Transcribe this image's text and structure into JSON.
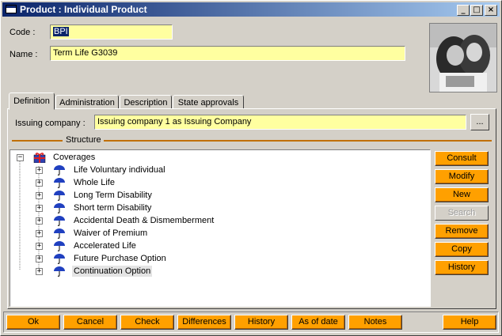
{
  "window": {
    "title": "Product : Individual Product"
  },
  "titlebar_buttons": {
    "minimize": "_",
    "maximize": "□",
    "close": "×"
  },
  "header": {
    "code_label": "Code :",
    "code_value": "BPI",
    "name_label": "Name :",
    "name_value": "Term Life  G3039"
  },
  "tabs": [
    {
      "label": "Definition",
      "active": true
    },
    {
      "label": "Administration",
      "active": false
    },
    {
      "label": "Description",
      "active": false
    },
    {
      "label": "State approvals",
      "active": false
    }
  ],
  "definition": {
    "issuing_label": "Issuing company :",
    "issuing_value": "Issuing company 1 as Issuing Company",
    "browse_label": "...",
    "structure_label": "Structure"
  },
  "tree": {
    "root": {
      "label": "Coverages",
      "icon": "gift-box-icon",
      "expander": "−"
    },
    "items": [
      {
        "label": "Life Voluntary individual",
        "icon": "umbrella-icon",
        "expander": "+"
      },
      {
        "label": "Whole Life",
        "icon": "umbrella-icon",
        "expander": "+"
      },
      {
        "label": "Long Term Disability",
        "icon": "umbrella-icon",
        "expander": "+"
      },
      {
        "label": "Short term Disability",
        "icon": "umbrella-icon",
        "expander": "+"
      },
      {
        "label": "Accidental Death & Dismemberment",
        "icon": "umbrella-icon",
        "expander": "+"
      },
      {
        "label": "Waiver of Premium",
        "icon": "umbrella-icon",
        "expander": "+"
      },
      {
        "label": "Accelerated Life",
        "icon": "umbrella-icon",
        "expander": "+"
      },
      {
        "label": "Future Purchase Option",
        "icon": "umbrella-icon",
        "expander": "+"
      },
      {
        "label": "Continuation Option",
        "icon": "umbrella-icon",
        "expander": "+",
        "selected": true
      }
    ]
  },
  "side_buttons": [
    {
      "label": "Consult",
      "enabled": true
    },
    {
      "label": "Modify",
      "enabled": true
    },
    {
      "label": "New",
      "enabled": true
    },
    {
      "label": "Search",
      "enabled": false
    },
    {
      "label": "Remove",
      "enabled": true
    },
    {
      "label": "Copy",
      "enabled": true
    },
    {
      "label": "History",
      "enabled": true
    }
  ],
  "bottom_buttons": [
    {
      "label": "Ok"
    },
    {
      "label": "Cancel"
    },
    {
      "label": "Check"
    },
    {
      "label": "Differences"
    },
    {
      "label": "History"
    },
    {
      "label": "As of date"
    },
    {
      "label": "Notes"
    },
    {
      "label": "Help"
    }
  ],
  "colors": {
    "field_bg": "#ffffa0",
    "action_button": "#ffa000",
    "title_start": "#0a246a",
    "title_end": "#a6caf0",
    "structure_line": "#c07000"
  }
}
